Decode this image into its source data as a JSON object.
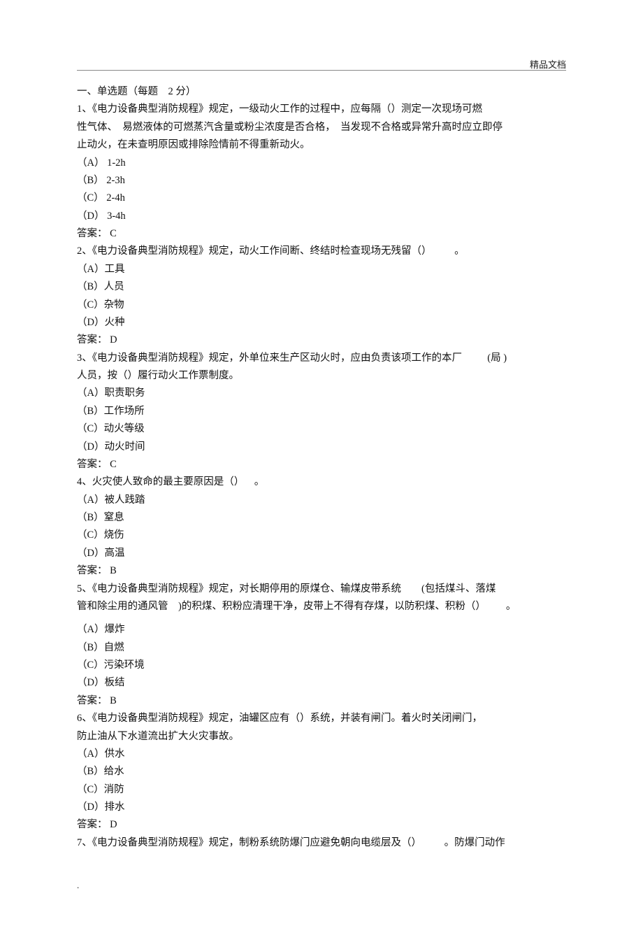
{
  "header": {
    "label": "精品文档"
  },
  "section_heading": "一、单选题（每题    2 分）",
  "questions": [
    {
      "stem_lines": [
        "1、《电力设备典型消防规程》规定，一级动火工作的过程中，应每隔（）测定一次现场可燃",
        "性气体、  易燃液体的可燃蒸汽含量或粉尘浓度是否合格，  当发现不合格或异常升高时应立即停",
        "止动火，在未查明原因或排除险情前不得重新动火。"
      ],
      "options": [
        "（A） 1-2h",
        "（B） 2-3h",
        "（C） 2-4h",
        "（D） 3-4h"
      ],
      "answer": "答案： C"
    },
    {
      "stem_lines": [
        "2、《电力设备典型消防规程》规定，动火工作间断、终结时检查现场无残留（）         。"
      ],
      "options": [
        "（A）工具",
        "（B）人员",
        "（C）杂物",
        "（D）火种"
      ],
      "answer": "答案： D"
    },
    {
      "stem_lines": [
        "3、《电力设备典型消防规程》规定，外单位来生产区动火时，应由负责该项工作的本厂          (局 )",
        "人员，按（）履行动火工作票制度。"
      ],
      "options": [
        "（A）职责职务",
        "（B）工作场所",
        "（C）动火等级",
        "（D）动火时间"
      ],
      "answer": "答案： C"
    },
    {
      "stem_lines": [
        "4、火灾使人致命的最主要原因是（）    。"
      ],
      "options": [
        "（A）被人践踏",
        "（B）窒息",
        "（C）烧伤",
        "（D）高温"
      ],
      "answer": "答案： B"
    },
    {
      "stem_lines": [
        "5、《电力设备典型消防规程》规定，对长期停用的原煤仓、输煤皮带系统        (包括煤斗、落煤",
        "管和除尘用的通风管    )的积煤、积粉应清理干净，皮带上不得有存煤，以防积煤、积粉（）        。"
      ],
      "gap_after_stem": true,
      "options": [
        "（A）爆炸",
        "（B）自燃",
        "（C）污染环境",
        "（D）板结"
      ],
      "answer": "答案： B"
    },
    {
      "stem_lines": [
        "6、《电力设备典型消防规程》规定，油罐区应有（）系统，并装有闸门。着火时关闭闸门，",
        "防止油从下水道流出扩大火灾事故。"
      ],
      "options": [
        "（A）供水",
        "（B）给水",
        "（C）消防",
        "（D）排水"
      ],
      "answer": "答案： D"
    },
    {
      "stem_lines": [
        "7、《电力设备典型消防规程》规定，制粉系统防爆门应避免朝向电缆层及（）         。防爆门动作"
      ],
      "options": [],
      "answer": null
    }
  ],
  "footer": {
    "dot": "."
  }
}
